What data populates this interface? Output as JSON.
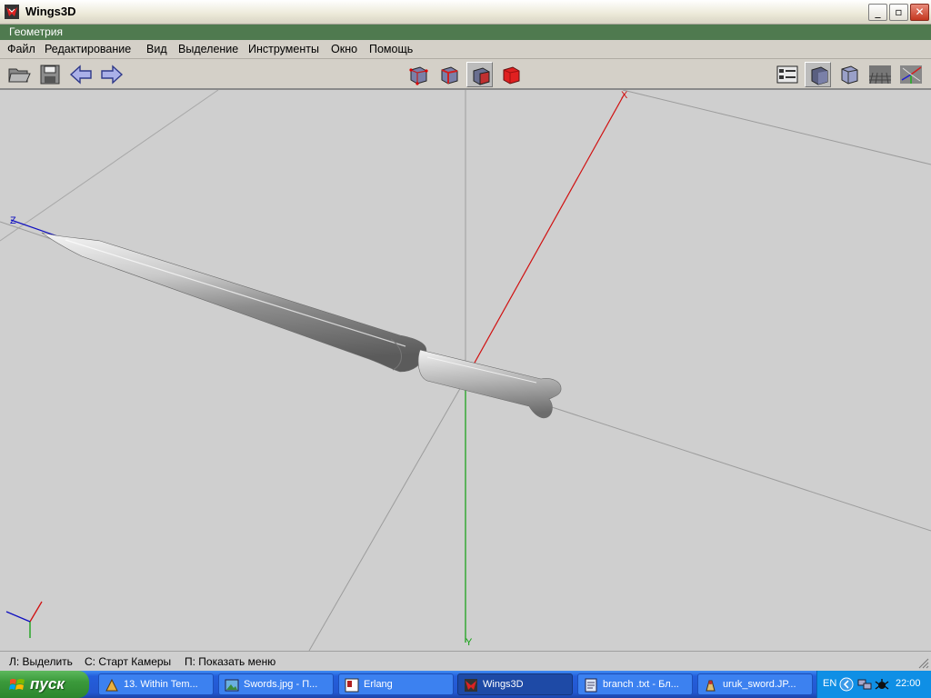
{
  "window": {
    "title": "Wings3D",
    "minimize": "_",
    "maximize": "▫",
    "close": "✕"
  },
  "mode_label": "Геометрия",
  "menu": [
    "Файл",
    "Редактирование",
    "Вид",
    "Выделение",
    "Инструменты",
    "Окно",
    "Помощь"
  ],
  "toolbar": {
    "left": [
      "open-icon",
      "save-icon",
      "undo-icon",
      "redo-icon"
    ],
    "selection_modes": [
      "vertex-mode-icon",
      "edge-mode-icon",
      "face-mode-icon",
      "object-mode-icon"
    ],
    "right": [
      "outliner-icon",
      "smooth-shade-icon",
      "wireframe-cube-icon",
      "ground-grid-icon",
      "axes-icon"
    ],
    "active_selection_mode": "face-mode-icon"
  },
  "viewport": {
    "axis_labels": {
      "x": "X",
      "y": "Y",
      "z": "Z"
    },
    "axis_colors": {
      "x": "#d01010",
      "y": "#10a010",
      "z": "#1010c0"
    },
    "background": "#cfcfcf"
  },
  "status": [
    "Л: Выделить",
    "С: Старт Камеры",
    "П: Показать меню"
  ],
  "taskbar": {
    "start_label": "пуск",
    "tasks": [
      {
        "label": "13. Within Tem...",
        "icon": "winamp-icon"
      },
      {
        "label": "Swords.jpg - П...",
        "icon": "image-viewer-icon"
      },
      {
        "label": "Erlang",
        "icon": "erlang-icon"
      },
      {
        "label": "Wings3D",
        "icon": "wings3d-icon"
      },
      {
        "label": "branch .txt - Бл...",
        "icon": "notepad-icon"
      },
      {
        "label": "uruk_sword.JP...",
        "icon": "paint-icon"
      }
    ],
    "active_task": "Wings3D",
    "tray": {
      "language": "EN",
      "clock": "22:00"
    }
  }
}
